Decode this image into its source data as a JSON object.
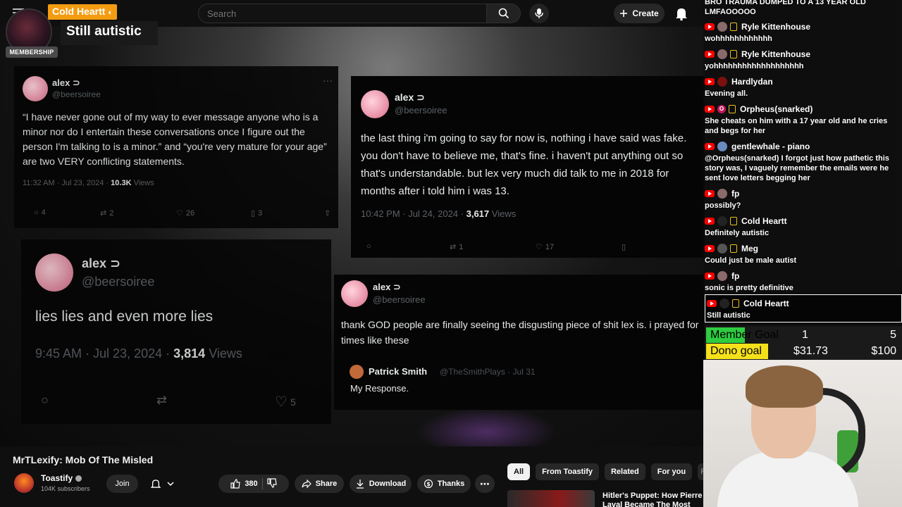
{
  "header": {
    "search_placeholder": "Search",
    "create_label": "Create"
  },
  "membership_popup": {
    "name": "Cold Heartt",
    "badge": "MEMBERSHIP",
    "message": "Still autistic"
  },
  "video": {
    "tweets": [
      {
        "name": "alex ⊃",
        "handle": "@beersoiree",
        "body": "“I have never gone out of my way to ever message anyone who is a minor nor do I entertain these conversations once I figure out the person I'm talking to is a minor.” and “you're very mature for your age” are two VERY conflicting statements.",
        "time": "11:32 AM · Jul 23, 2024 ·",
        "views_count": "10.3K",
        "views_label": "Views",
        "replies": "4",
        "retweets": "2",
        "likes": "26",
        "bookmarks": "3"
      },
      {
        "name": "alex ⊃",
        "handle": "@beersoiree",
        "body": "the last thing i'm going to say for now is, nothing i have said was fake. you don't have to believe me, that's fine. i haven't put anything out so that's understandable. but lex very much did talk to me in 2018 for months after i told him i was 13.",
        "time": "10:42 PM · Jul 24, 2024 ·",
        "views_count": "3,617",
        "views_label": "Views",
        "retweets": "1",
        "likes": "17"
      },
      {
        "name": "alex ⊃",
        "handle": "@beersoiree",
        "body": "lies lies and even more lies",
        "time": "9:45 AM · Jul 23, 2024 ·",
        "views_count": "3,814",
        "views_label": "Views",
        "likes": "5"
      },
      {
        "name": "alex ⊃",
        "handle": "@beersoiree",
        "body": "thank GOD people are finally seeing the disgusting piece of shit lex is. i prayed for times like these",
        "quote_name": "Patrick Smith",
        "quote_handle": "@TheSmithPlays · Jul 31",
        "quote_body": "My Response."
      }
    ]
  },
  "chat": {
    "messages": [
      {
        "name": "",
        "text": "BRO TRAUMA DUMPED TO A 13 YEAR OLD LMFAOOOOO"
      },
      {
        "name": "Ryle Kittenhouse",
        "text": "wohhhhhhhhhhhh"
      },
      {
        "name": "Ryle Kittenhouse",
        "text": "yohhhhhhhhhhhhhhhhhhh"
      },
      {
        "name": "Hardlydan",
        "text": "Evening all."
      },
      {
        "name": "Orpheus(snarked)",
        "text": "She cheats on him with a 17 year old and he cries and begs for her"
      },
      {
        "name": "gentlewhale - piano",
        "text": "@Orpheus(snarked) I forgot just how pathetic this story was, I vaguely remember the emails were he sent love letters begging her"
      },
      {
        "name": "fp",
        "text": "possibly?"
      },
      {
        "name": "Cold Heartt",
        "text": "Definitely autistic"
      },
      {
        "name": "Meg",
        "text": "Could just be male autist"
      },
      {
        "name": "fp",
        "text": "sonic is pretty definitive"
      },
      {
        "name": "Cold Heartt",
        "text": "Still autistic"
      }
    ]
  },
  "goals": {
    "member": {
      "label": "Member Goal",
      "current": "1",
      "target": "5",
      "progress": 0.2,
      "color": "#2ecc40"
    },
    "dono": {
      "label": "Dono goal",
      "current": "$31.73",
      "target": "$100",
      "progress": 0.3173,
      "color": "#f5e11a"
    }
  },
  "below": {
    "title": "MrTLexify: Mob Of The Misled",
    "channel_name": "Toastify",
    "subscribers": "104K subscribers",
    "join_label": "Join",
    "likes": "380",
    "share_label": "Share",
    "download_label": "Download",
    "thanks_label": "Thanks",
    "chips": [
      "All",
      "From Toastify",
      "Related",
      "For you",
      "R"
    ],
    "rec_title": "Hitler's Puppet: How Pierre Laval Became The Most Hated"
  }
}
